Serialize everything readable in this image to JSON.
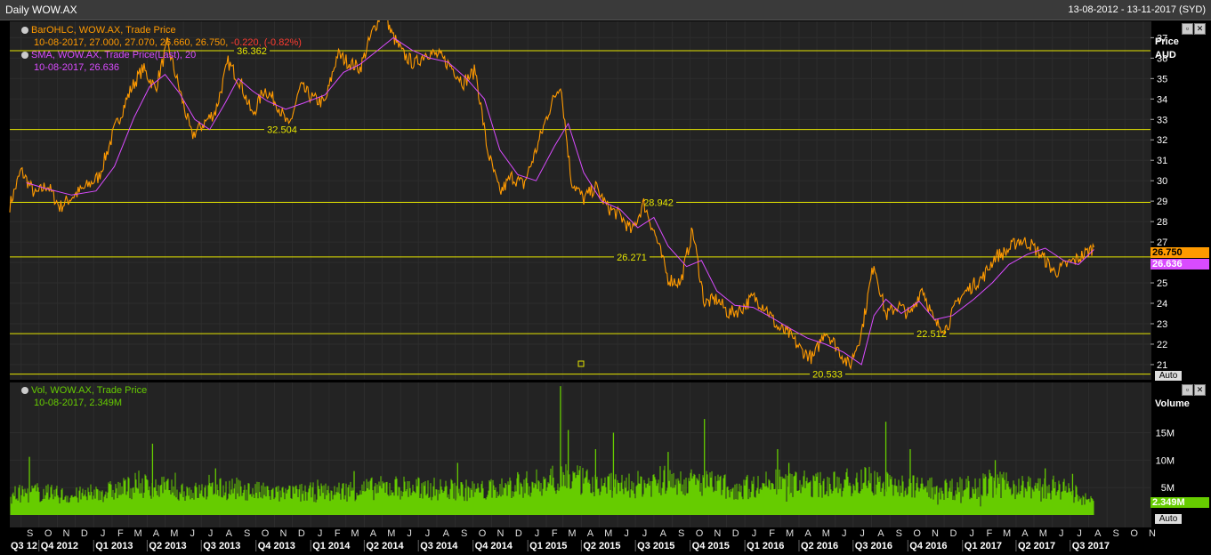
{
  "window": {
    "title": "Daily WOW.AX",
    "date_range": "13-08-2012 - 13-11-2017 (SYD)"
  },
  "legend": {
    "ohlc_line1": "BarOHLC, WOW.AX, Trade Price",
    "ohlc_line2": "10-08-2017, 27.000, 27.070, 26.660, 26.750,",
    "ohlc_change": "-0.220, (-0.82%)",
    "sma_line1": "SMA, WOW.AX, Trade Price(Last),  20",
    "sma_line2": "10-08-2017, 26.636",
    "vol_line1": "Vol, WOW.AX, Trade Price",
    "vol_line2": "10-08-2017, 2.349M"
  },
  "axis": {
    "price_title": "Price",
    "price_unit": "AUD",
    "volume_title": "Volume",
    "auto_label": "Auto",
    "price_ticks": [
      "21",
      "22",
      "23",
      "24",
      "25",
      "26",
      "27",
      "28",
      "29",
      "30",
      "31",
      "32",
      "33",
      "34",
      "35",
      "36",
      "37"
    ],
    "volume_ticks": [
      "5M",
      "10M",
      "15M"
    ],
    "last_price_tag": "26.750",
    "last_sma_tag": "26.636",
    "last_volume_tag": "2.349M"
  },
  "colors": {
    "price": "#ff9a00",
    "sma": "#d94bff",
    "hline": "#e6e600",
    "volume": "#66cc00",
    "grid": "#2d2d2d",
    "change_negative": "#ff3b30"
  },
  "chart_data": {
    "type": "line",
    "symbol": "WOW.AX",
    "start_date": "2012-08-13",
    "end_date": "2017-11-13",
    "last_date": "2017-08-10",
    "last_ohlc": {
      "open": 27.0,
      "high": 27.07,
      "low": 26.66,
      "close": 26.75
    },
    "last_change": -0.22,
    "last_change_pct": -0.82,
    "sma_period": 20,
    "last_sma": 26.636,
    "last_volume": "2.349M",
    "ylim": [
      20.3,
      37.8
    ],
    "volume_ylim": [
      0,
      24
    ],
    "horizontal_lines": [
      36.362,
      32.504,
      28.942,
      26.271,
      22.512,
      20.533
    ],
    "month_labels": [
      "S",
      "O",
      "N",
      "D",
      "J",
      "F",
      "M",
      "A",
      "M",
      "J",
      "J",
      "A",
      "S",
      "O",
      "N",
      "D",
      "J",
      "F",
      "M",
      "A",
      "M",
      "J",
      "J",
      "A",
      "S",
      "O",
      "N",
      "D",
      "J",
      "F",
      "M",
      "A",
      "M",
      "J",
      "J",
      "A",
      "S",
      "O",
      "N",
      "D",
      "J",
      "F",
      "M",
      "A",
      "M",
      "J",
      "J",
      "A",
      "S",
      "O",
      "N",
      "D",
      "J",
      "F",
      "M",
      "A",
      "M",
      "J",
      "J",
      "A",
      "S",
      "O",
      "N"
    ],
    "quarter_labels": [
      "Q3 12",
      "Q4 2012",
      "Q1 2013",
      "Q2 2013",
      "Q3 2013",
      "Q4 2013",
      "Q1 2014",
      "Q2 2014",
      "Q3 2014",
      "Q4 2014",
      "Q1 2015",
      "Q2 2015",
      "Q3 2015",
      "Q4 2015",
      "Q1 2016",
      "Q2 2016",
      "Q3 2016",
      "Q4 2016",
      "Q1 2017",
      "Q2 2017",
      "Q3 2017"
    ],
    "series": [
      {
        "name": "BarOHLC, WOW.AX, Trade Price",
        "x": [
          "2012-08-13",
          "2012-09-01",
          "2012-09-25",
          "2012-10-15",
          "2012-11-05",
          "2012-11-25",
          "2012-12-15",
          "2013-01-10",
          "2013-02-05",
          "2013-03-05",
          "2013-03-25",
          "2013-04-15",
          "2013-05-05",
          "2013-05-25",
          "2013-06-15",
          "2013-07-05",
          "2013-07-25",
          "2013-08-15",
          "2013-09-05",
          "2013-09-25",
          "2013-10-15",
          "2013-11-05",
          "2013-11-25",
          "2013-12-15",
          "2014-01-05",
          "2014-01-25",
          "2014-02-15",
          "2014-03-05",
          "2014-03-25",
          "2014-04-15",
          "2014-05-05",
          "2014-05-15",
          "2014-06-05",
          "2014-06-25",
          "2014-07-15",
          "2014-08-05",
          "2014-08-25",
          "2014-09-15",
          "2014-10-05",
          "2014-10-25",
          "2014-11-15",
          "2014-12-05",
          "2014-12-25",
          "2015-01-15",
          "2015-02-05",
          "2015-02-25",
          "2015-03-15",
          "2015-04-05",
          "2015-04-25",
          "2015-05-15",
          "2015-06-05",
          "2015-06-25",
          "2015-07-15",
          "2015-08-05",
          "2015-08-25",
          "2015-09-15",
          "2015-10-05",
          "2015-10-25",
          "2015-11-15",
          "2015-12-05",
          "2015-12-25",
          "2016-01-15",
          "2016-02-05",
          "2016-02-25",
          "2016-03-15",
          "2016-04-05",
          "2016-04-25",
          "2016-05-15",
          "2016-06-05",
          "2016-06-25",
          "2016-07-15",
          "2016-08-05",
          "2016-08-25",
          "2016-09-15",
          "2016-10-05",
          "2016-10-25",
          "2016-11-15",
          "2016-12-05",
          "2016-12-25",
          "2017-01-15",
          "2017-02-05",
          "2017-02-25",
          "2017-03-15",
          "2017-04-05",
          "2017-04-25",
          "2017-05-15",
          "2017-06-05",
          "2017-06-25",
          "2017-07-15",
          "2017-08-10"
        ],
        "values": [
          28.8,
          30.5,
          29.3,
          29.8,
          28.7,
          29.2,
          29.6,
          30.2,
          32.5,
          34.5,
          35.5,
          34.5,
          36.7,
          34.5,
          32.2,
          32.8,
          33.4,
          35.8,
          34.8,
          33.2,
          34.5,
          33.8,
          32.6,
          34.6,
          34.0,
          33.8,
          36.2,
          35.8,
          35.5,
          37.3,
          38.5,
          37.3,
          36.2,
          35.7,
          36.3,
          36.1,
          35.6,
          34.8,
          35.4,
          31.5,
          29.4,
          30.2,
          29.8,
          31.5,
          33.4,
          34.8,
          30.0,
          29.1,
          29.7,
          28.7,
          28.3,
          27.5,
          28.9,
          27.2,
          25.2,
          25.0,
          27.6,
          24.0,
          24.2,
          23.5,
          23.7,
          24.3,
          23.8,
          22.8,
          22.5,
          21.7,
          21.3,
          22.7,
          21.8,
          20.9,
          22.6,
          26.0,
          23.4,
          23.9,
          23.4,
          24.8,
          23.0,
          22.8,
          24.2,
          24.8,
          25.3,
          26.3,
          26.5,
          27.1,
          26.9,
          26.3,
          25.5,
          25.9,
          26.2,
          26.75
        ]
      },
      {
        "name": "SMA, WOW.AX, Trade Price(Last),  20",
        "x": [
          "2012-09-10",
          "2012-10-15",
          "2012-11-25",
          "2013-01-05",
          "2013-02-05",
          "2013-03-10",
          "2013-04-05",
          "2013-05-01",
          "2013-05-25",
          "2013-06-20",
          "2013-07-15",
          "2013-08-10",
          "2013-09-01",
          "2013-09-25",
          "2013-10-20",
          "2013-11-20",
          "2013-12-20",
          "2014-01-25",
          "2014-02-25",
          "2014-03-25",
          "2014-04-20",
          "2014-05-20",
          "2014-06-20",
          "2014-07-20",
          "2014-08-20",
          "2014-09-20",
          "2014-10-20",
          "2014-11-15",
          "2014-12-15",
          "2015-01-15",
          "2015-02-15",
          "2015-03-10",
          "2015-04-05",
          "2015-05-05",
          "2015-06-05",
          "2015-07-05",
          "2015-08-01",
          "2015-08-25",
          "2015-09-25",
          "2015-10-20",
          "2015-11-15",
          "2015-12-15",
          "2016-01-15",
          "2016-02-15",
          "2016-03-15",
          "2016-04-15",
          "2016-05-15",
          "2016-06-15",
          "2016-07-15",
          "2016-08-05",
          "2016-08-25",
          "2016-09-20",
          "2016-10-20",
          "2016-11-15",
          "2016-12-15",
          "2017-01-20",
          "2017-02-20",
          "2017-03-20",
          "2017-04-20",
          "2017-05-20",
          "2017-06-20",
          "2017-07-15",
          "2017-08-10"
        ],
        "values": [
          29.9,
          29.6,
          29.3,
          29.5,
          30.7,
          33.1,
          34.6,
          35.2,
          34.3,
          33.0,
          32.5,
          33.8,
          35.0,
          34.4,
          33.9,
          33.5,
          33.8,
          34.2,
          35.3,
          35.7,
          36.3,
          37.0,
          36.4,
          36.0,
          35.8,
          35.0,
          34.0,
          31.5,
          30.3,
          30.0,
          31.7,
          32.8,
          30.4,
          29.0,
          28.6,
          27.7,
          28.2,
          26.8,
          25.8,
          26.1,
          24.6,
          23.9,
          23.8,
          23.3,
          22.8,
          22.3,
          22.0,
          21.6,
          21.0,
          23.4,
          24.2,
          23.5,
          24.1,
          23.2,
          23.4,
          24.2,
          25.0,
          25.9,
          26.4,
          26.7,
          26.1,
          25.9,
          26.636
        ]
      },
      {
        "name": "Vol, WOW.AX, Trade Price",
        "x": [
          "2012-08-13",
          "2012-09-25",
          "2012-11-25",
          "2013-02-15",
          "2013-03-15",
          "2013-05-15",
          "2013-06-25",
          "2013-08-20",
          "2013-11-05",
          "2014-02-25",
          "2014-05-20",
          "2014-08-25",
          "2014-10-25",
          "2014-12-10",
          "2015-01-15",
          "2015-02-25",
          "2015-04-05",
          "2015-06-25",
          "2015-08-20",
          "2015-10-25",
          "2015-12-15",
          "2016-02-25",
          "2016-05-20",
          "2016-07-25",
          "2016-08-25",
          "2016-10-20",
          "2016-12-15",
          "2017-02-20",
          "2017-04-20",
          "2017-06-20",
          "2017-08-10"
        ],
        "values": [
          3.6,
          4.2,
          3.4,
          4.6,
          5.5,
          4.8,
          4.2,
          4.9,
          3.8,
          4.4,
          5.1,
          4.6,
          4.4,
          5.3,
          5.8,
          7.2,
          6.0,
          5.4,
          6.3,
          5.8,
          4.9,
          5.9,
          5.4,
          6.5,
          5.5,
          5.2,
          4.8,
          5.6,
          5.1,
          4.7,
          2.349
        ]
      }
    ],
    "volume_spikes": [
      {
        "x": "2012-09-15",
        "value": 10.6
      },
      {
        "x": "2013-04-10",
        "value": 13.0
      },
      {
        "x": "2013-07-25",
        "value": 8.5
      },
      {
        "x": "2014-03-15",
        "value": 8.0
      },
      {
        "x": "2014-09-05",
        "value": 9.5
      },
      {
        "x": "2014-12-15",
        "value": 7.8
      },
      {
        "x": "2015-02-25",
        "value": 23.5
      },
      {
        "x": "2015-03-10",
        "value": 15.5
      },
      {
        "x": "2015-04-25",
        "value": 12.0
      },
      {
        "x": "2015-05-25",
        "value": 15.0
      },
      {
        "x": "2015-08-25",
        "value": 11.5
      },
      {
        "x": "2015-10-25",
        "value": 17.5
      },
      {
        "x": "2016-02-25",
        "value": 12.0
      },
      {
        "x": "2016-03-15",
        "value": 9.5
      },
      {
        "x": "2016-08-25",
        "value": 17.0
      },
      {
        "x": "2016-10-05",
        "value": 12.0
      },
      {
        "x": "2017-02-25",
        "value": 10.0
      },
      {
        "x": "2017-05-20",
        "value": 8.5
      },
      {
        "x": "2017-07-05",
        "value": 7.5
      }
    ]
  }
}
